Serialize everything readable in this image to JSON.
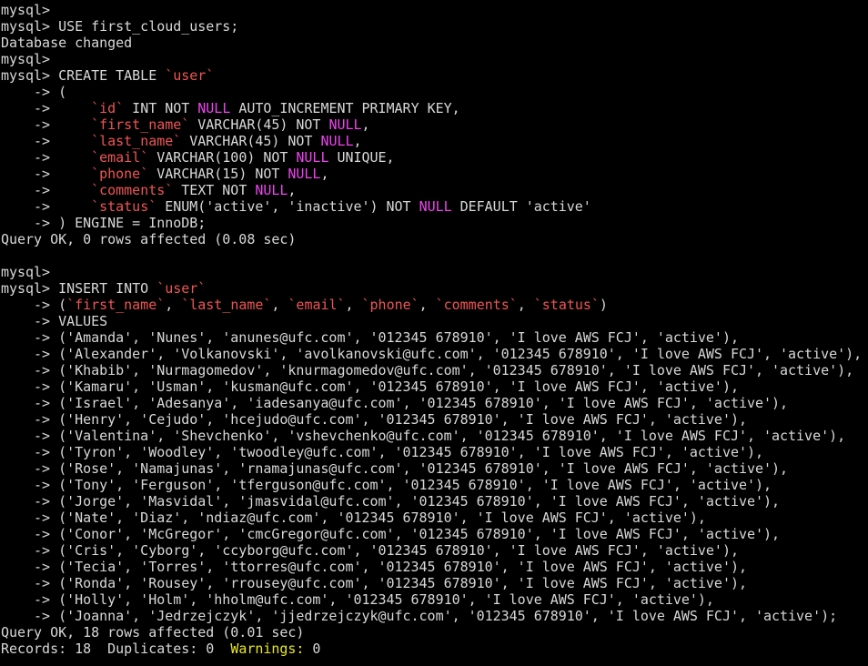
{
  "terminal": {
    "colors": {
      "background": "#000000",
      "text": "#d8d8d8",
      "backtick_identifier": "#ee5555",
      "null_keyword": "#ee44ee",
      "warnings_label": "#e8e81a"
    },
    "lines": [
      [
        {
          "t": "mysql>"
        }
      ],
      [
        {
          "t": "mysql> USE first_cloud_users;"
        }
      ],
      [
        {
          "t": "Database changed"
        }
      ],
      [
        {
          "t": "mysql>"
        }
      ],
      [
        {
          "t": "mysql> CREATE TABLE "
        },
        {
          "t": "`user`",
          "c": "bt"
        }
      ],
      [
        {
          "t": "    -> ("
        }
      ],
      [
        {
          "t": "    ->     "
        },
        {
          "t": "`id`",
          "c": "bt"
        },
        {
          "t": " INT NOT "
        },
        {
          "t": "NULL",
          "c": "kw"
        },
        {
          "t": " AUTO_INCREMENT PRIMARY KEY,"
        }
      ],
      [
        {
          "t": "    ->     "
        },
        {
          "t": "`first_name`",
          "c": "bt"
        },
        {
          "t": " VARCHAR(45) NOT "
        },
        {
          "t": "NULL",
          "c": "kw"
        },
        {
          "t": ","
        }
      ],
      [
        {
          "t": "    ->     "
        },
        {
          "t": "`last_name`",
          "c": "bt"
        },
        {
          "t": " VARCHAR(45) NOT "
        },
        {
          "t": "NULL",
          "c": "kw"
        },
        {
          "t": ","
        }
      ],
      [
        {
          "t": "    ->     "
        },
        {
          "t": "`email`",
          "c": "bt"
        },
        {
          "t": " VARCHAR(100) NOT "
        },
        {
          "t": "NULL",
          "c": "kw"
        },
        {
          "t": " UNIQUE,"
        }
      ],
      [
        {
          "t": "    ->     "
        },
        {
          "t": "`phone`",
          "c": "bt"
        },
        {
          "t": " VARCHAR(15) NOT "
        },
        {
          "t": "NULL",
          "c": "kw"
        },
        {
          "t": ","
        }
      ],
      [
        {
          "t": "    ->     "
        },
        {
          "t": "`comments`",
          "c": "bt"
        },
        {
          "t": " TEXT NOT "
        },
        {
          "t": "NULL",
          "c": "kw"
        },
        {
          "t": ","
        }
      ],
      [
        {
          "t": "    ->     "
        },
        {
          "t": "`status`",
          "c": "bt"
        },
        {
          "t": " ENUM('active', 'inactive') NOT "
        },
        {
          "t": "NULL",
          "c": "kw"
        },
        {
          "t": " DEFAULT 'active'"
        }
      ],
      [
        {
          "t": "    -> ) ENGINE = InnoDB;"
        }
      ],
      [
        {
          "t": "Query OK, 0 rows affected (0.08 sec)"
        }
      ],
      [
        {
          "t": ""
        }
      ],
      [
        {
          "t": "mysql>"
        }
      ],
      [
        {
          "t": "mysql> INSERT INTO "
        },
        {
          "t": "`user`",
          "c": "bt"
        }
      ],
      [
        {
          "t": "    -> ("
        },
        {
          "t": "`first_name`",
          "c": "bt"
        },
        {
          "t": ", "
        },
        {
          "t": "`last_name`",
          "c": "bt"
        },
        {
          "t": ", "
        },
        {
          "t": "`email`",
          "c": "bt"
        },
        {
          "t": ", "
        },
        {
          "t": "`phone`",
          "c": "bt"
        },
        {
          "t": ", "
        },
        {
          "t": "`comments`",
          "c": "bt"
        },
        {
          "t": ", "
        },
        {
          "t": "`status`",
          "c": "bt"
        },
        {
          "t": ")"
        }
      ],
      [
        {
          "t": "    -> VALUES"
        }
      ],
      [
        {
          "t": "    -> ('Amanda', 'Nunes', 'anunes@ufc.com', '012345 678910', 'I love AWS FCJ', 'active'),"
        }
      ],
      [
        {
          "t": "    -> ('Alexander', 'Volkanovski', 'avolkanovski@ufc.com', '012345 678910', 'I love AWS FCJ', 'active'),"
        }
      ],
      [
        {
          "t": "    -> ('Khabib', 'Nurmagomedov', 'knurmagomedov@ufc.com', '012345 678910', 'I love AWS FCJ', 'active'),"
        }
      ],
      [
        {
          "t": "    -> ('Kamaru', 'Usman', 'kusman@ufc.com', '012345 678910', 'I love AWS FCJ', 'active'),"
        }
      ],
      [
        {
          "t": "    -> ('Israel', 'Adesanya', 'iadesanya@ufc.com', '012345 678910', 'I love AWS FCJ', 'active'),"
        }
      ],
      [
        {
          "t": "    -> ('Henry', 'Cejudo', 'hcejudo@ufc.com', '012345 678910', 'I love AWS FCJ', 'active'),"
        }
      ],
      [
        {
          "t": "    -> ('Valentina', 'Shevchenko', 'vshevchenko@ufc.com', '012345 678910', 'I love AWS FCJ', 'active'),"
        }
      ],
      [
        {
          "t": "    -> ('Tyron', 'Woodley', 'twoodley@ufc.com', '012345 678910', 'I love AWS FCJ', 'active'),"
        }
      ],
      [
        {
          "t": "    -> ('Rose', 'Namajunas', 'rnamajunas@ufc.com', '012345 678910', 'I love AWS FCJ', 'active'),"
        }
      ],
      [
        {
          "t": "    -> ('Tony', 'Ferguson', 'tferguson@ufc.com', '012345 678910', 'I love AWS FCJ', 'active'),"
        }
      ],
      [
        {
          "t": "    -> ('Jorge', 'Masvidal', 'jmasvidal@ufc.com', '012345 678910', 'I love AWS FCJ', 'active'),"
        }
      ],
      [
        {
          "t": "    -> ('Nate', 'Diaz', 'ndiaz@ufc.com', '012345 678910', 'I love AWS FCJ', 'active'),"
        }
      ],
      [
        {
          "t": "    -> ('Conor', 'McGregor', 'cmcGregor@ufc.com', '012345 678910', 'I love AWS FCJ', 'active'),"
        }
      ],
      [
        {
          "t": "    -> ('Cris', 'Cyborg', 'ccyborg@ufc.com', '012345 678910', 'I love AWS FCJ', 'active'),"
        }
      ],
      [
        {
          "t": "    -> ('Tecia', 'Torres', 'ttorres@ufc.com', '012345 678910', 'I love AWS FCJ', 'active'),"
        }
      ],
      [
        {
          "t": "    -> ('Ronda', 'Rousey', 'rrousey@ufc.com', '012345 678910', 'I love AWS FCJ', 'active'),"
        }
      ],
      [
        {
          "t": "    -> ('Holly', 'Holm', 'hholm@ufc.com', '012345 678910', 'I love AWS FCJ', 'active'),"
        }
      ],
      [
        {
          "t": "    -> ('Joanna', 'Jedrzejczyk', 'jjedrzejczyk@ufc.com', '012345 678910', 'I love AWS FCJ', 'active');"
        }
      ],
      [
        {
          "t": "Query OK, 18 rows affected (0.01 sec)"
        }
      ],
      [
        {
          "t": "Records: 18  Duplicates: 0  "
        },
        {
          "t": "Warnings:",
          "c": "warn"
        },
        {
          "t": " 0"
        }
      ]
    ]
  }
}
